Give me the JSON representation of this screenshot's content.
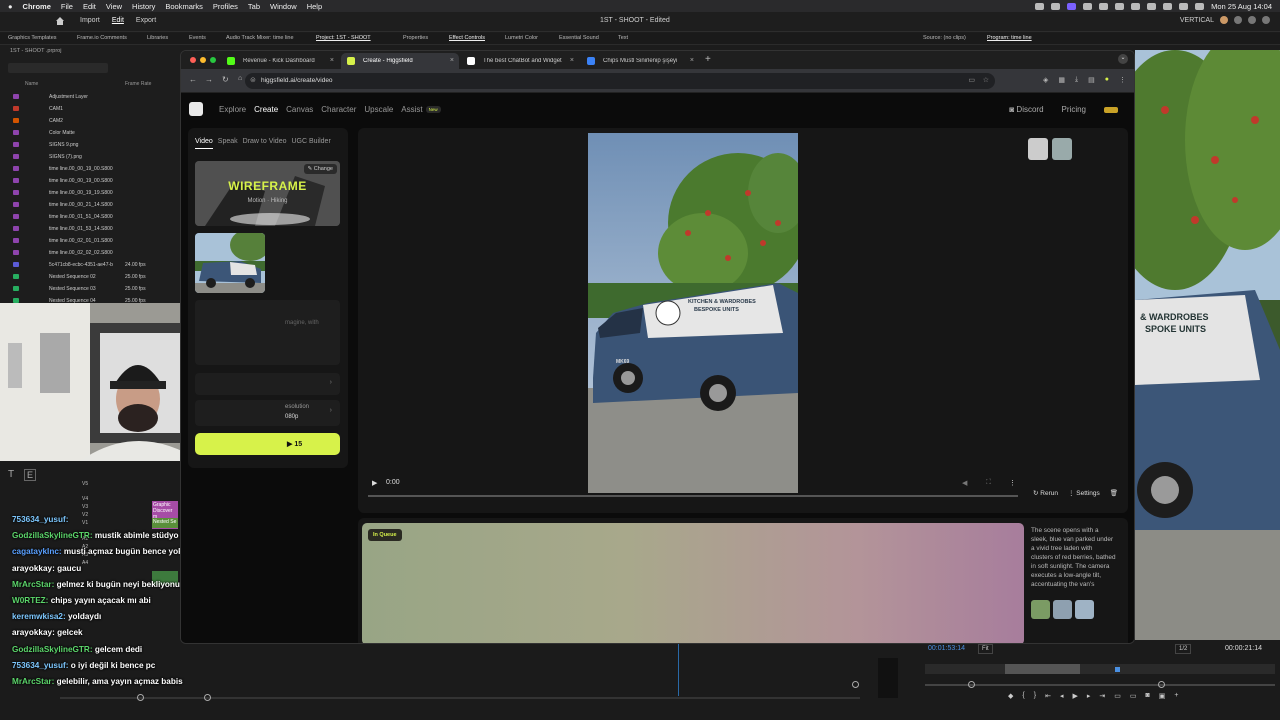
{
  "menubar": {
    "app": "Chrome",
    "items": [
      "File",
      "Edit",
      "View",
      "History",
      "Bookmarks",
      "Profiles",
      "Tab",
      "Window",
      "Help"
    ],
    "datetime": "Mon 25 Aug  14:04"
  },
  "premiere": {
    "nav": [
      "Import",
      "Edit",
      "Export"
    ],
    "active_nav": "Edit",
    "title": "1ST - SHOOT  -  Edited",
    "workspace": "VERTICAL",
    "panel_tabs": [
      "Graphics Templates",
      "Frame.io Comments",
      "Libraries",
      "Events",
      "Audio Track Mixer: time line",
      "Project: 1ST - SHOOT",
      "Properties",
      "Effect Controls",
      "Lumetri Color",
      "Essential Sound",
      "Text",
      "Source: (no clips)",
      "Program: time line"
    ],
    "project_file": "1ST - SHOOT .prproj",
    "col_name": "Name",
    "col_rate": "Frame Rate",
    "items": [
      {
        "name": "Adjustment Layer",
        "rate": "",
        "color": "#8e44ad"
      },
      {
        "name": "CAM1",
        "rate": "",
        "color": "#c0392b"
      },
      {
        "name": "CAM2",
        "rate": "",
        "color": "#d35400"
      },
      {
        "name": "Color Matte",
        "rate": "",
        "color": "#8e44ad"
      },
      {
        "name": "SIGNS 9.png",
        "rate": "",
        "color": "#8e44ad"
      },
      {
        "name": "SIGNS (7).png",
        "rate": "",
        "color": "#8e44ad"
      },
      {
        "name": "time line.00_00_19_00.S800",
        "rate": "",
        "color": "#8e44ad"
      },
      {
        "name": "time line.00_00_19_00.S800",
        "rate": "",
        "color": "#8e44ad"
      },
      {
        "name": "time line.00_00_19_19.S800",
        "rate": "",
        "color": "#8e44ad"
      },
      {
        "name": "time line.00_00_21_14.S800",
        "rate": "",
        "color": "#8e44ad"
      },
      {
        "name": "time line.00_01_51_04.S800",
        "rate": "",
        "color": "#8e44ad"
      },
      {
        "name": "time line.00_01_53_14.S800",
        "rate": "",
        "color": "#8e44ad"
      },
      {
        "name": "time line.00_02_01_01.S800",
        "rate": "",
        "color": "#8e44ad"
      },
      {
        "name": "time line.00_02_02_02.S800",
        "rate": "",
        "color": "#8e44ad"
      },
      {
        "name": "5c471cb8-ecbc-4351-ae47-b",
        "rate": "24.00 fps",
        "color": "#5b5bd6"
      },
      {
        "name": "Nested Sequence 02",
        "rate": "25.00 fps",
        "color": "#27ae60"
      },
      {
        "name": "Nested Sequence 03",
        "rate": "25.00 fps",
        "color": "#27ae60"
      },
      {
        "name": "Nested Sequence 04",
        "rate": "25.00 fps",
        "color": "#27ae60"
      }
    ],
    "program_timecode": "00:01:53:14",
    "program_fit": "Fit",
    "program_res": "1/2",
    "program_duration": "00:00:21:14"
  },
  "chrome": {
    "tabs": [
      {
        "label": "Revenue - Kick Dashboard",
        "color": "#53fc18",
        "active": false
      },
      {
        "label": "Create - Higgsfield",
        "color": "#d7f24a",
        "active": true
      },
      {
        "label": "The best ChatBot and Widget",
        "color": "#ffffff",
        "active": false
      },
      {
        "label": "Chips Mustl Sinirlenip şişeyi",
        "color": "#3b82f6",
        "active": false
      }
    ],
    "url": "higgsfield.ai/create/video"
  },
  "site": {
    "nav": [
      "Explore",
      "Create",
      "Canvas",
      "Character",
      "Upscale",
      "Assist"
    ],
    "active_nav": "Create",
    "new_badge": "New",
    "discord": "Discord",
    "pricing": "Pricing",
    "mode_tabs": [
      "Video",
      "Speak",
      "Draw to Video",
      "UGC Builder"
    ],
    "active_mode": "Video",
    "preset_title": "WIREFRAME",
    "preset_sub": "Motion · Hiking",
    "change": "Change",
    "prompt_placeholder": "magine, with",
    "resolution_label": "esolution",
    "resolution_value": "080p",
    "generate_cost": "15",
    "video_time": "0:00",
    "rerun": "Rerun",
    "settings": "Settings",
    "queue_badge": "In Queue",
    "description": "The scene opens with a sleek, blue van parked under a vivid tree laden with clusters of red berries, bathed in soft sunlight. The camera executes a low-angle tilt, accentuating the van's",
    "van_text1": "KITCHEN & WARDROBES",
    "van_text2": "BESPOKE UNITS",
    "van_plate": "MK69"
  },
  "right_preview": {
    "text1": "& WARDROBES",
    "text2": "SPOKE UNITS"
  },
  "timeline": {
    "tracks": [
      "V5",
      "V4",
      "V3",
      "V2",
      "V1",
      "A1",
      "A2",
      "A3",
      "A4"
    ],
    "clip_labels": [
      "Graphic",
      "Discover m",
      "Nested Se"
    ]
  },
  "chat": [
    {
      "user": "753634_yusuf",
      "color": "#7ec8ff",
      "msg": ""
    },
    {
      "user": "GodzillaSkylineGTR",
      "color": "#5cd66b",
      "msg": "mustik abimle stüdyo arası"
    },
    {
      "user": "cagataykInc",
      "color": "#5aa0ff",
      "msg": "musti açmaz bugün bence yoksa şimdi gelmişti"
    },
    {
      "user": "arayokkay",
      "color": "#ffffff",
      "msg": "gaucu"
    },
    {
      "user": "MrArcStar",
      "color": "#5cd66b",
      "msg": "gelmez ki bugün neyi bekliyonuz"
    },
    {
      "user": "W0RTEZ",
      "color": "#5cd66b",
      "msg": "chips yayın açacak mı abi"
    },
    {
      "user": "keremwkisa2",
      "color": "#7ec8ff",
      "msg": "yoldaydı"
    },
    {
      "user": "arayokkay",
      "color": "#ffffff",
      "msg": "gelcek"
    },
    {
      "user": "GodzillaSkylineGTR",
      "color": "#5cd66b",
      "msg": "gelcem dedi"
    },
    {
      "user": "753634_yusuf",
      "color": "#7ec8ff",
      "msg": "o iyi değil ki bence pc"
    },
    {
      "user": "MrArcStar",
      "color": "#5cd66b",
      "msg": "gelebilir, ama yayın açmaz babis"
    }
  ],
  "colors": {
    "accent": "#d7f24a",
    "premiere_bg": "#1c1c1c"
  }
}
